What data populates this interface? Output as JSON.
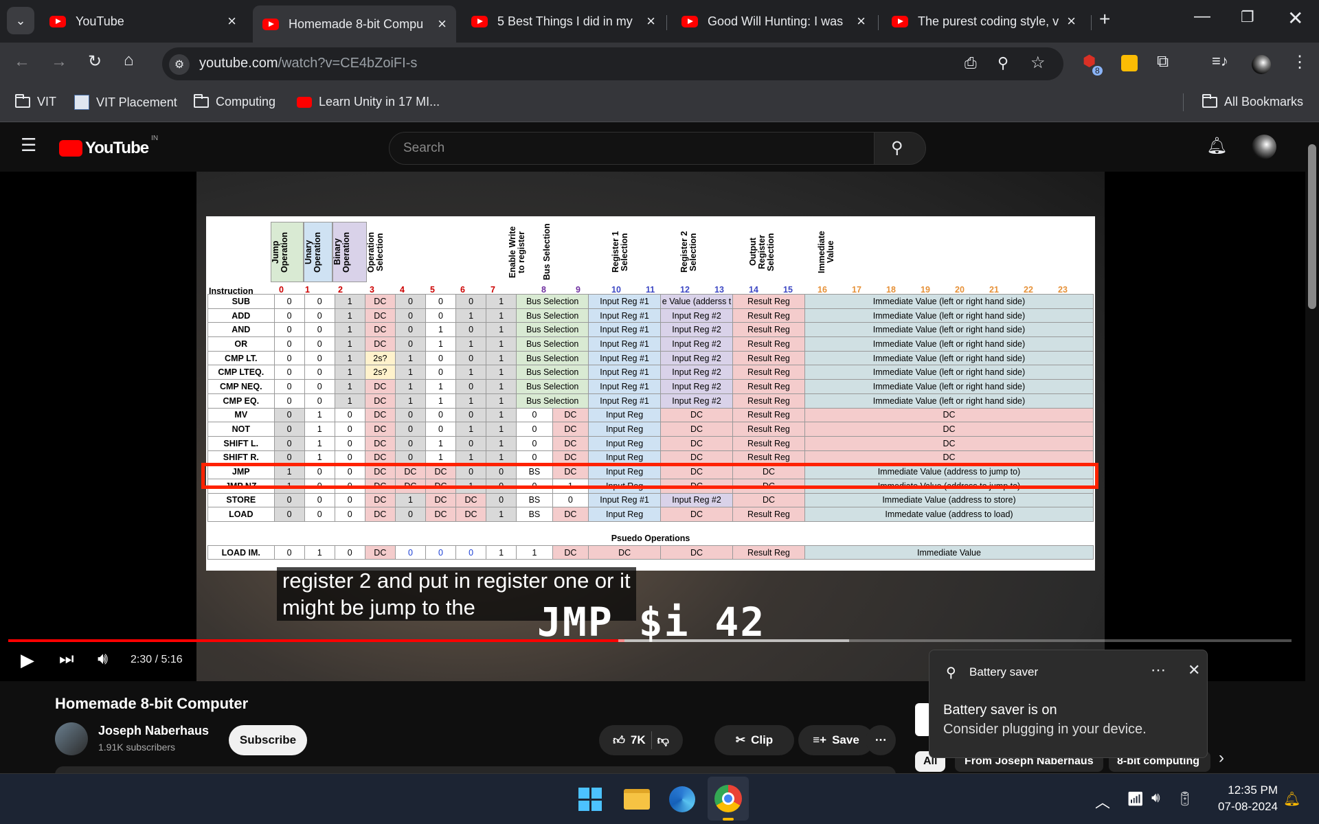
{
  "tabs": [
    {
      "title": "YouTube"
    },
    {
      "title": "Homemade 8-bit Compu"
    },
    {
      "title": "5 Best Things I did in my"
    },
    {
      "title": "Good Will Hunting: I was"
    },
    {
      "title": "The purest coding style, v"
    }
  ],
  "address": {
    "url_domain": "youtube.com",
    "url_path": "/watch?v=CE4bZoiFI-s",
    "extension_badge": "8"
  },
  "bookmarks": [
    {
      "label": "VIT",
      "icon": "folder-icon"
    },
    {
      "label": "VIT Placement",
      "icon": "site-icon"
    },
    {
      "label": "Computing",
      "icon": "folder-icon"
    },
    {
      "label": "Learn Unity in 17 MI...",
      "icon": "youtube-icon"
    }
  ],
  "all_bookmarks": "All Bookmarks",
  "yt": {
    "logo": "YouTube",
    "region": "IN",
    "search_placeholder": "Search"
  },
  "sheet": {
    "instruction_header": "Instruction",
    "headers": [
      "Jump Operation",
      "Unary Operation",
      "Binary Operation",
      "Operation Selection",
      "Enable Write to register",
      "Bus Selection",
      "Register 1 Selection",
      "Register 2 Selection",
      "Output Register Selection",
      "Immediate Value"
    ],
    "bit_numbers": [
      "0",
      "1",
      "2",
      "3",
      "4",
      "5",
      "6",
      "7",
      "8",
      "9",
      "10",
      "11",
      "12",
      "13",
      "14",
      "15",
      "16",
      "17",
      "18",
      "19",
      "20",
      "21",
      "22",
      "23"
    ],
    "rows": [
      [
        "SUB",
        "0",
        "0",
        "1",
        "DC",
        "0",
        "0",
        "0",
        "1",
        "Bus Selection",
        "Input Reg #1",
        "e Value (adderss t",
        "Result Reg",
        "Immediate Value (left or right hand side)"
      ],
      [
        "ADD",
        "0",
        "0",
        "1",
        "DC",
        "0",
        "0",
        "1",
        "1",
        "Bus Selection",
        "Input Reg #1",
        "Input Reg #2",
        "Result Reg",
        "Immediate Value (left or right hand side)"
      ],
      [
        "AND",
        "0",
        "0",
        "1",
        "DC",
        "0",
        "1",
        "0",
        "1",
        "Bus Selection",
        "Input Reg #1",
        "Input Reg #2",
        "Result Reg",
        "Immediate Value (left or right hand side)"
      ],
      [
        "OR",
        "0",
        "0",
        "1",
        "DC",
        "0",
        "1",
        "1",
        "1",
        "Bus Selection",
        "Input Reg #1",
        "Input Reg #2",
        "Result Reg",
        "Immediate Value (left or right hand side)"
      ],
      [
        "CMP LT.",
        "0",
        "0",
        "1",
        "2s?",
        "1",
        "0",
        "0",
        "1",
        "Bus Selection",
        "Input Reg #1",
        "Input Reg #2",
        "Result Reg",
        "Immediate Value (left or right hand side)"
      ],
      [
        "CMP LTEQ.",
        "0",
        "0",
        "1",
        "2s?",
        "1",
        "0",
        "1",
        "1",
        "Bus Selection",
        "Input Reg #1",
        "Input Reg #2",
        "Result Reg",
        "Immediate Value (left or right hand side)"
      ],
      [
        "CMP NEQ.",
        "0",
        "0",
        "1",
        "DC",
        "1",
        "1",
        "0",
        "1",
        "Bus Selection",
        "Input Reg #1",
        "Input Reg #2",
        "Result Reg",
        "Immediate Value (left or right hand side)"
      ],
      [
        "CMP EQ.",
        "0",
        "0",
        "1",
        "DC",
        "1",
        "1",
        "1",
        "1",
        "Bus Selection",
        "Input Reg #1",
        "Input Reg #2",
        "Result Reg",
        "Immediate Value (left or right hand side)"
      ]
    ],
    "unary_rows": [
      [
        "MV",
        "0",
        "1",
        "0",
        "DC",
        "0",
        "0",
        "0",
        "1",
        "0",
        "DC",
        "Input Reg",
        "DC",
        "Result Reg",
        "DC"
      ],
      [
        "NOT",
        "0",
        "1",
        "0",
        "DC",
        "0",
        "0",
        "1",
        "1",
        "0",
        "DC",
        "Input Reg",
        "DC",
        "Result Reg",
        "DC"
      ],
      [
        "SHIFT L.",
        "0",
        "1",
        "0",
        "DC",
        "0",
        "1",
        "0",
        "1",
        "0",
        "DC",
        "Input Reg",
        "DC",
        "Result Reg",
        "DC"
      ],
      [
        "SHIFT R.",
        "0",
        "1",
        "0",
        "DC",
        "0",
        "1",
        "1",
        "1",
        "0",
        "DC",
        "Input Reg",
        "DC",
        "Result Reg",
        "DC"
      ],
      [
        "JMP",
        "1",
        "0",
        "0",
        "DC",
        "DC",
        "DC",
        "0",
        "0",
        "BS",
        "DC",
        "Input Reg",
        "DC",
        "DC",
        "Immediate Value (address to jump to)"
      ],
      [
        "JMP NZ",
        "1",
        "0",
        "0",
        "DC",
        "DC",
        "DC",
        "1",
        "0",
        "0",
        "1",
        "Input Reg",
        "DC",
        "DC",
        "Immediate Value (address to jump to)"
      ],
      [
        "STORE",
        "0",
        "0",
        "0",
        "DC",
        "1",
        "DC",
        "DC",
        "0",
        "BS",
        "0",
        "Input Reg #1",
        "Input Reg #2",
        "DC",
        "Immediate Value (address to store)"
      ],
      [
        "LOAD",
        "0",
        "0",
        "0",
        "DC",
        "0",
        "DC",
        "DC",
        "1",
        "BS",
        "DC",
        "Input Reg",
        "DC",
        "Result Reg",
        "Immedate value (address to load)"
      ]
    ],
    "pseudo_header": "Psuedo Operations",
    "pseudo_row": [
      "LOAD IM.",
      "0",
      "1",
      "0",
      "DC",
      "0",
      "0",
      "0",
      "1",
      "1",
      "DC",
      "DC",
      "DC",
      "Result Reg",
      "Immediate Value"
    ]
  },
  "caption": {
    "line1": "register 2 and put in register one or it",
    "line2": "might be jump to the"
  },
  "code_overlay": "JMP $i 42",
  "player": {
    "time": "2:30 / 5:16",
    "progress": 0.48
  },
  "video": {
    "title": "Homemade 8-bit Computer",
    "channel": "Joseph Naberhaus",
    "subscribers": "1.91K subscribers",
    "subscribe": "Subscribe",
    "likes": "7K",
    "clip": "Clip",
    "save": "Save"
  },
  "chips": [
    "All",
    "From Joseph Naberhaus",
    "8-bit computing"
  ],
  "toast": {
    "app": "Battery saver",
    "title": "Battery saver is on",
    "body": "Consider plugging in your device."
  },
  "clock": {
    "time": "12:35 PM",
    "date": "07-08-2024"
  }
}
